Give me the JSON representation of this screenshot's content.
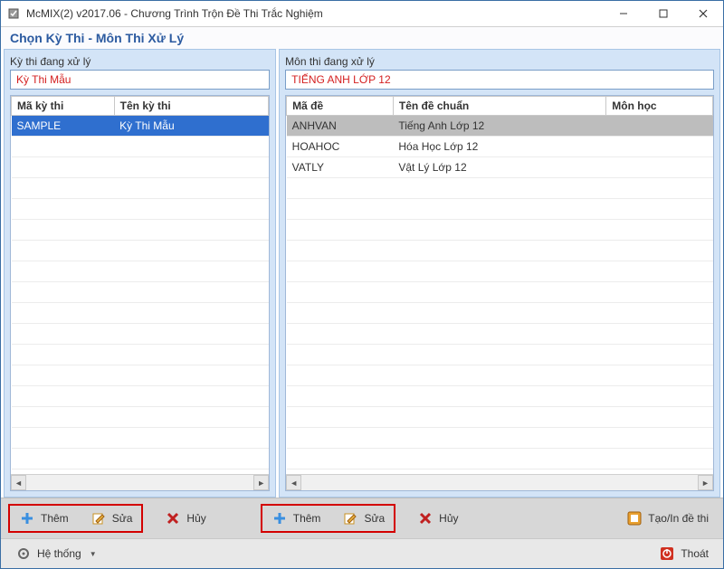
{
  "window": {
    "title": "McMIX(2) v2017.06 - Chương Trình Trộn Đề Thi Trắc Nghiệm",
    "subtitle": "Chọn Kỳ Thi - Môn Thi Xử Lý"
  },
  "left_panel": {
    "label": "Kỳ thi đang xử lý",
    "value": "Kỳ Thi Mẫu",
    "columns": {
      "c1": "Mã kỳ thi",
      "c2": "Tên kỳ thi"
    },
    "rows": [
      {
        "c1": "SAMPLE",
        "c2": "Kỳ Thi Mẫu",
        "state": "selected-blue"
      }
    ],
    "buttons": {
      "add": "Thêm",
      "edit": "Sửa",
      "cancel": "Hủy"
    }
  },
  "right_panel": {
    "label": "Môn thi đang xử lý",
    "value": "TIẾNG ANH LỚP 12",
    "columns": {
      "c1": "Mã đề",
      "c2": "Tên đề chuẩn",
      "c3": "Môn học"
    },
    "rows": [
      {
        "c1": "ANHVAN",
        "c2": "Tiếng Anh Lớp 12",
        "c3": "",
        "state": "selected-grey"
      },
      {
        "c1": "HOAHOC",
        "c2": "Hóa Học Lớp 12",
        "c3": "",
        "state": ""
      },
      {
        "c1": "VATLY",
        "c2": "Vật Lý Lớp 12",
        "c3": "",
        "state": ""
      }
    ],
    "buttons": {
      "add": "Thêm",
      "edit": "Sửa",
      "cancel": "Hủy",
      "print": "Tạo/In đề thi"
    }
  },
  "statusbar": {
    "system": "Hệ thống",
    "exit": "Thoát"
  },
  "icons": {
    "plus": "plus-icon",
    "pencil": "pencil-icon",
    "xred": "x-red-icon",
    "printer": "printer-icon",
    "gear": "gear-icon",
    "power": "power-icon"
  }
}
